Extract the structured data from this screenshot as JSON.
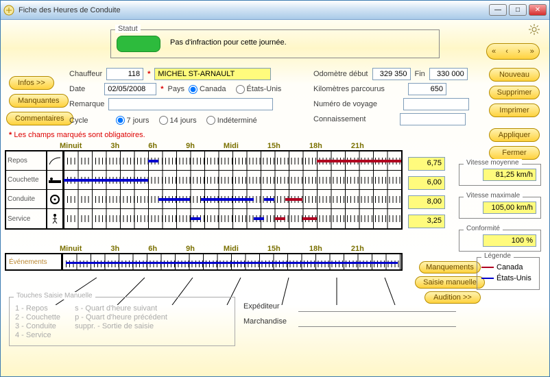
{
  "window": {
    "title": "Fiche des Heures de Conduite"
  },
  "status": {
    "label": "Statut",
    "text": "Pas d'infraction pour cette journée."
  },
  "nav": {
    "first": "«",
    "prev": "‹",
    "next": "›",
    "last": "»"
  },
  "sideButtons": {
    "infos": "Infos >>",
    "manquantes": "Manquantes",
    "commentaires": "Commentaires"
  },
  "actionButtons": {
    "nouveau": "Nouveau",
    "supprimer": "Supprimer",
    "imprimer": "Imprimer",
    "appliquer": "Appliquer",
    "fermer": "Fermer"
  },
  "form": {
    "chauffeurLabel": "Chauffeur",
    "chauffeurId": "118",
    "chauffeurName": "MICHEL ST-ARNAULT",
    "dateLabel": "Date",
    "date": "02/05/2008",
    "paysLabel": "Pays",
    "paysCanada": "Canada",
    "paysUS": "États-Unis",
    "remarqueLabel": "Remarque",
    "remarque": "",
    "cycleLabel": "Cycle",
    "cycle7": "7 jours",
    "cycle14": "14 jours",
    "cycleInd": "Indéterminé",
    "odoDebutLabel": "Odomètre début",
    "odoDebut": "329 350",
    "finLabel": "Fin",
    "fin": "330 000",
    "kmLabel": "Kilomètres parcourus",
    "km": "650",
    "voyageLabel": "Numéro de voyage",
    "voyage": "",
    "connLabel": "Connaissement",
    "conn": ""
  },
  "obligatoires": "Les champs marqués sont obligatoires.",
  "timeHeader": [
    "Minuit",
    "3h",
    "6h",
    "9h",
    "Midi",
    "15h",
    "18h",
    "21h"
  ],
  "rowLabels": {
    "repos": "Repos",
    "couchette": "Couchette",
    "conduite": "Conduite",
    "service": "Service"
  },
  "rowValues": {
    "repos": "6,75",
    "couchette": "6,00",
    "conduite": "8,00",
    "service": "3,25"
  },
  "stats": {
    "vmLabel": "Vitesse moyenne",
    "vm": "81,25 km/h",
    "vmaxLabel": "Vitesse maximale",
    "vmax": "105,00 km/h",
    "confLabel": "Conformité",
    "conf": "100 %"
  },
  "eventsLabel": "Événements",
  "bottomButtons": {
    "manquements": "Manquements",
    "saisie": "Saisie manuelle",
    "audition": "Audition >>"
  },
  "legend": {
    "label": "Légende",
    "canada": "Canada",
    "us": "États-Unis"
  },
  "manual": {
    "title": "Touches Saisie Manuelle",
    "c1": [
      "1 - Repos",
      "2 - Couchette",
      "3 - Conduite",
      "4 - Service"
    ],
    "c2": [
      "s - Quart d'heure suivant",
      "p - Quart d'heure précédent",
      "suppr. - Sortie de saisie"
    ]
  },
  "ship": {
    "expLabel": "Expéditeur",
    "marchLabel": "Marchandise"
  },
  "chart_data": {
    "type": "timeline",
    "x_unit": "hours",
    "x_range": [
      0,
      24
    ],
    "states": [
      "Repos",
      "Couchette",
      "Conduite",
      "Service"
    ],
    "segments": [
      {
        "state": "Couchette",
        "from": 0,
        "to": 6,
        "series": "États-Unis"
      },
      {
        "state": "Repos",
        "from": 6,
        "to": 6.75,
        "series": "États-Unis"
      },
      {
        "state": "Conduite",
        "from": 6.75,
        "to": 9,
        "series": "États-Unis"
      },
      {
        "state": "Service",
        "from": 9,
        "to": 9.75,
        "series": "États-Unis"
      },
      {
        "state": "Conduite",
        "from": 9.75,
        "to": 13.5,
        "series": "États-Unis"
      },
      {
        "state": "Service",
        "from": 13.5,
        "to": 14.25,
        "series": "États-Unis"
      },
      {
        "state": "Conduite",
        "from": 14.25,
        "to": 15,
        "series": "États-Unis"
      },
      {
        "state": "Service",
        "from": 15,
        "to": 15.75,
        "series": "Canada"
      },
      {
        "state": "Conduite",
        "from": 15.75,
        "to": 17,
        "series": "Canada"
      },
      {
        "state": "Service",
        "from": 17,
        "to": 18,
        "series": "Canada"
      },
      {
        "state": "Repos",
        "from": 18,
        "to": 24,
        "series": "Canada"
      }
    ],
    "totals_hours": {
      "Repos": 6.75,
      "Couchette": 6.0,
      "Conduite": 8.0,
      "Service": 3.25
    },
    "events": [
      {
        "from": 0,
        "to": 24,
        "series": "États-Unis"
      }
    ],
    "legend": {
      "Canada": "#b00020",
      "États-Unis": "#0000cd"
    }
  }
}
